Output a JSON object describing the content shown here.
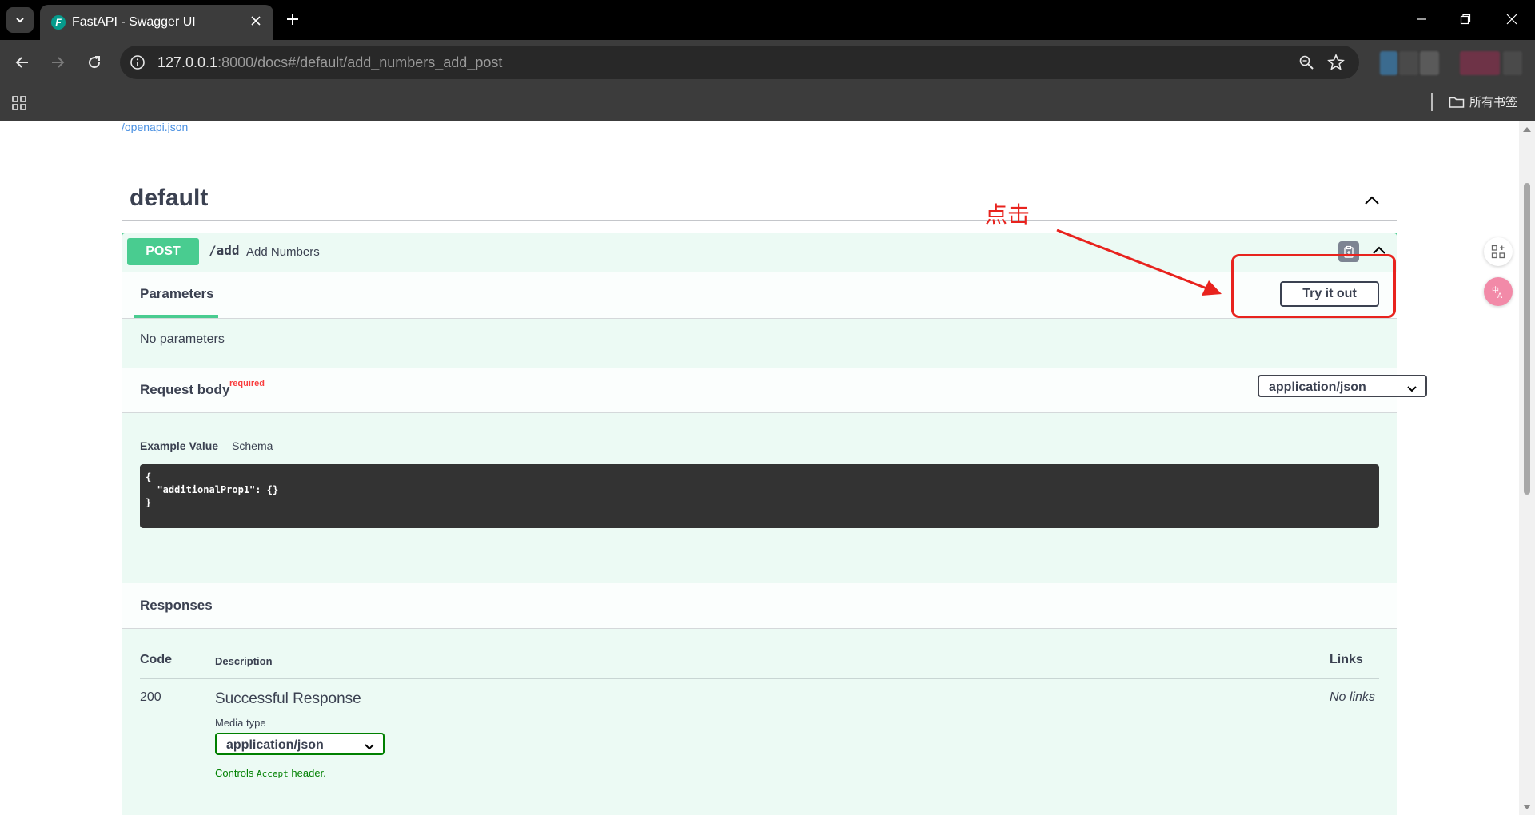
{
  "browser": {
    "tab_title": "FastAPI - Swagger UI",
    "url_host": "127.0.0.1",
    "url_rest": ":8000/docs#/default/add_numbers_add_post",
    "bookmarks_folder": "所有书签"
  },
  "page": {
    "openapi_link": "/openapi.json",
    "section_title": "default",
    "operation": {
      "method": "POST",
      "path": "/add",
      "summary": "Add Numbers"
    },
    "parameters": {
      "tab_label": "Parameters",
      "try_button": "Try it out",
      "empty_text": "No parameters"
    },
    "request_body": {
      "title": "Request body",
      "required_tag": "required",
      "content_type": "application/json",
      "example_tab": "Example Value",
      "schema_tab": "Schema",
      "example_code": "{\n  \"additionalProp1\": {}\n}"
    },
    "responses": {
      "title": "Responses",
      "col_code": "Code",
      "col_description": "Description",
      "col_links": "Links",
      "rows": [
        {
          "code": "200",
          "description": "Successful Response",
          "links": "No links",
          "media_type_label": "Media type",
          "media_type": "application/json",
          "controls_prefix": "Controls",
          "controls_code": "Accept",
          "controls_suffix": "header."
        }
      ]
    }
  },
  "annotation": {
    "label": "点击",
    "color": "#e8231e"
  },
  "colors": {
    "post_green": "#49cc90",
    "text": "#3b4151",
    "link": "#4990e2"
  }
}
